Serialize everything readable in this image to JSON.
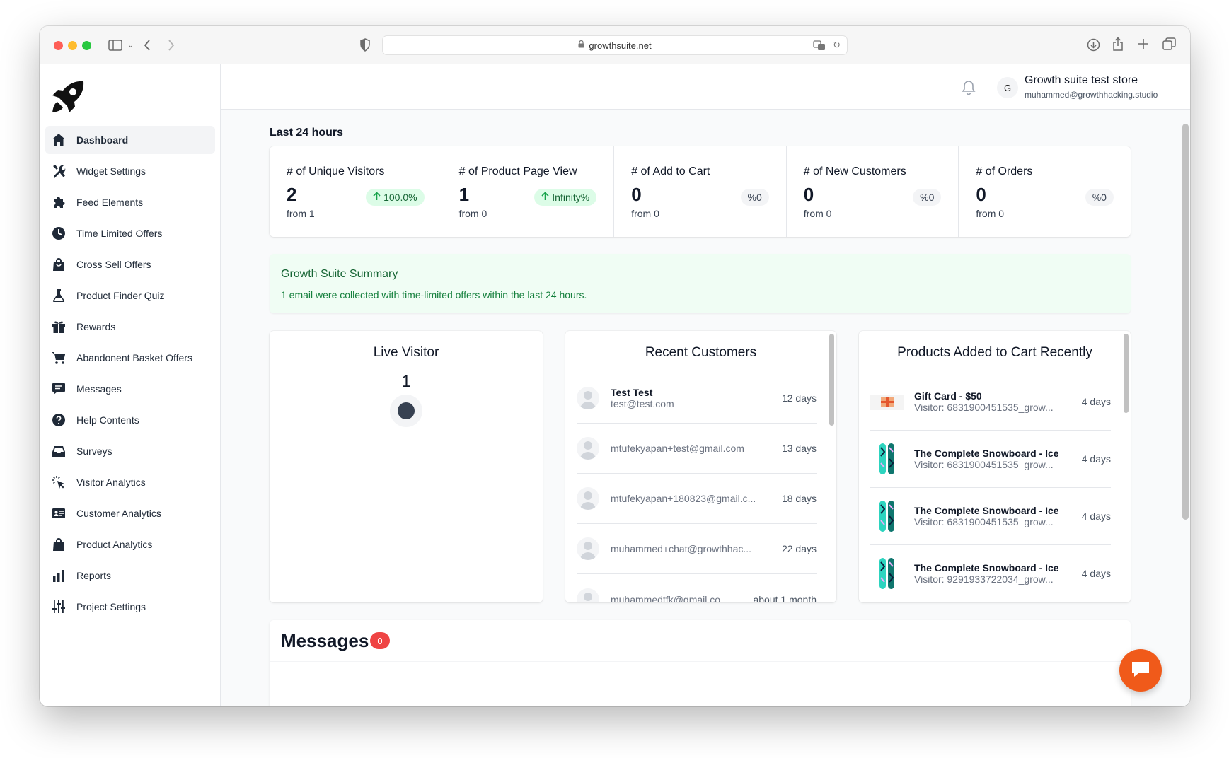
{
  "browser": {
    "url": "growthsuite.net"
  },
  "header": {
    "avatar_initial": "G",
    "store_name": "Growth suite test store",
    "store_email": "muhammed@growthhacking.studio"
  },
  "sidebar": {
    "items": [
      {
        "label": "Dashboard",
        "icon": "home-icon",
        "active": true
      },
      {
        "label": "Widget Settings",
        "icon": "tools-icon"
      },
      {
        "label": "Feed Elements",
        "icon": "puzzle-icon"
      },
      {
        "label": "Time Limited Offers",
        "icon": "clock-icon"
      },
      {
        "label": "Cross Sell Offers",
        "icon": "shopping-bag-icon"
      },
      {
        "label": "Product Finder Quiz",
        "icon": "flask-icon"
      },
      {
        "label": "Rewards",
        "icon": "gift-icon"
      },
      {
        "label": "Abandonent Basket Offers",
        "icon": "cart-icon"
      },
      {
        "label": "Messages",
        "icon": "message-icon"
      },
      {
        "label": "Help Contents",
        "icon": "question-icon"
      },
      {
        "label": "Surveys",
        "icon": "inbox-icon"
      },
      {
        "label": "Visitor Analytics",
        "icon": "cursor-click-icon"
      },
      {
        "label": "Customer Analytics",
        "icon": "id-card-icon"
      },
      {
        "label": "Product Analytics",
        "icon": "product-bag-icon"
      },
      {
        "label": "Reports",
        "icon": "bar-chart-icon"
      },
      {
        "label": "Project Settings",
        "icon": "sliders-icon"
      }
    ]
  },
  "main": {
    "section_title": "Last 24 hours",
    "stats": [
      {
        "label": "# of Unique Visitors",
        "value": "2",
        "from": "from 1",
        "badge": "100.0%",
        "trend": "up",
        "badge_color": "#dcfce7"
      },
      {
        "label": "# of Product Page View",
        "value": "1",
        "from": "from 0",
        "badge": "Infinity%",
        "trend": "up",
        "badge_color": "#dcfce7"
      },
      {
        "label": "# of Add to Cart",
        "value": "0",
        "from": "from 0",
        "badge": "%0",
        "trend": "none",
        "badge_color": "#f3f4f6"
      },
      {
        "label": "# of New Customers",
        "value": "0",
        "from": "from 0",
        "badge": "%0",
        "trend": "none",
        "badge_color": "#f3f4f6"
      },
      {
        "label": "# of Orders",
        "value": "0",
        "from": "from 0",
        "badge": "%0",
        "trend": "none",
        "badge_color": "#f3f4f6"
      }
    ],
    "summary": {
      "title": "Growth Suite Summary",
      "text": "1 email were collected with time-limited offers within the last 24 hours."
    },
    "live_visitor": {
      "title": "Live Visitor",
      "count": "1"
    },
    "recent_customers": {
      "title": "Recent Customers",
      "items": [
        {
          "name": "Test Test",
          "email": "test@test.com",
          "time": "12 days"
        },
        {
          "name": "",
          "email": "mtufekyapan+test@gmail.com",
          "time": "13 days"
        },
        {
          "name": "",
          "email": "mtufekyapan+180823@gmail.c...",
          "time": "18 days"
        },
        {
          "name": "",
          "email": "muhammed+chat@growthhac...",
          "time": "22 days"
        },
        {
          "name": "",
          "email": "muhammedtfk@gmail.co...",
          "time": "about 1 month"
        }
      ]
    },
    "products_added": {
      "title": "Products Added to Cart Recently",
      "items": [
        {
          "name": "Gift Card - $50",
          "visitor": "Visitor: 6831900451535_grow...",
          "time": "4 days",
          "thumb": "gift-card"
        },
        {
          "name": "The Complete Snowboard - Ice",
          "visitor": "Visitor: 6831900451535_grow...",
          "time": "4 days",
          "thumb": "snowboard"
        },
        {
          "name": "The Complete Snowboard - Ice",
          "visitor": "Visitor: 6831900451535_grow...",
          "time": "4 days",
          "thumb": "snowboard"
        },
        {
          "name": "The Complete Snowboard - Ice",
          "visitor": "Visitor: 9291933722034_grow...",
          "time": "4 days",
          "thumb": "snowboard"
        }
      ]
    },
    "messages": {
      "title": "Messages",
      "count": "0"
    }
  },
  "colors": {
    "accent_orange": "#f05a1a",
    "success_green": "#166534",
    "badge_red": "#ef4444"
  }
}
